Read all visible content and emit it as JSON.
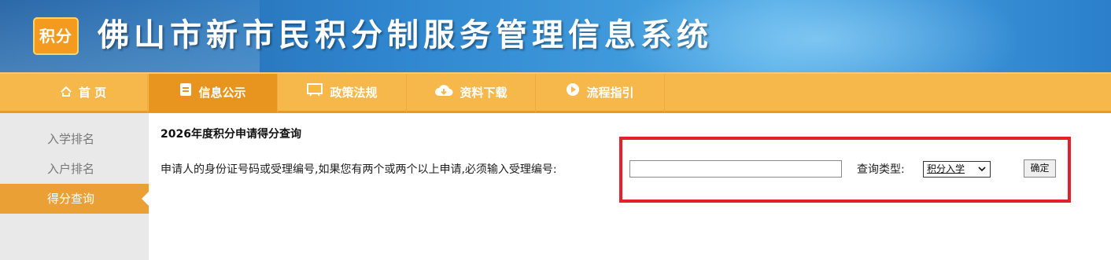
{
  "header": {
    "logo_text": "积分",
    "system_title": "佛山市新市民积分制服务管理信息系统"
  },
  "nav": {
    "items": [
      {
        "label": "首 页",
        "icon": "home-icon"
      },
      {
        "label": "信息公示",
        "icon": "notice-icon"
      },
      {
        "label": "政策法规",
        "icon": "policy-board-icon"
      },
      {
        "label": "资料下载",
        "icon": "cloud-download-icon"
      },
      {
        "label": "流程指引",
        "icon": "play-circle-icon"
      }
    ],
    "active_index": 1
  },
  "sidebar": {
    "items": [
      {
        "label": "入学排名"
      },
      {
        "label": "入户排名"
      },
      {
        "label": "得分查询"
      }
    ],
    "active_index": 2
  },
  "main": {
    "title": "2026年度积分申请得分查询",
    "prompt": "申请人的身份证号码或受理编号,如果您有两个或两个以上申请,必须输入受理编号:",
    "id_input_value": "",
    "type_label": "查询类型:",
    "type_selected": "积分入学",
    "confirm_label": "确定"
  },
  "colors": {
    "nav_bg": "#f7b84b",
    "nav_active": "#e8951f",
    "sidebar_active": "#eaa034",
    "highlight": "#e4202a",
    "header_blue": "#2f86cf"
  }
}
